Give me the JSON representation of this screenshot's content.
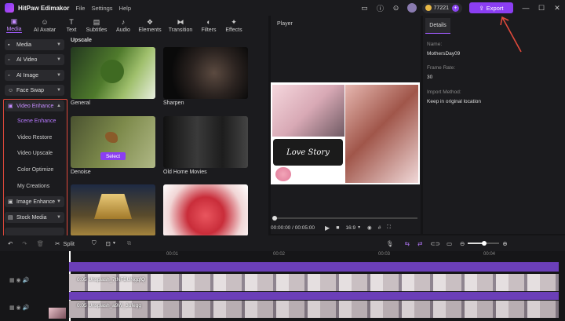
{
  "app": {
    "name": "HitPaw Edimakor",
    "menus": [
      "File",
      "Settings",
      "Help"
    ],
    "coins": "77221",
    "export_label": "Export"
  },
  "tabs": [
    {
      "label": "Media",
      "icon": "media-icon"
    },
    {
      "label": "AI Avatar",
      "icon": "avatar-icon"
    },
    {
      "label": "Text",
      "icon": "text-icon"
    },
    {
      "label": "Subtitles",
      "icon": "subtitles-icon"
    },
    {
      "label": "Audio",
      "icon": "audio-icon"
    },
    {
      "label": "Elements",
      "icon": "elements-icon"
    },
    {
      "label": "Transition",
      "icon": "transition-icon"
    },
    {
      "label": "Filters",
      "icon": "filters-icon"
    },
    {
      "label": "Effects",
      "icon": "effects-icon"
    }
  ],
  "sidebar": {
    "media": "Media",
    "ai_video": "AI Video",
    "ai_image": "AI Image",
    "face_swap": "Face Swap",
    "video_enhance": "Video Enhance",
    "subitems": [
      "Scene Enhance",
      "Video Restore",
      "Video Upscale",
      "Color Optimize",
      "My Creations"
    ],
    "image_enhance": "Image Enhance",
    "stock_media": "Stock Media"
  },
  "content": {
    "category": "Upscale",
    "items": [
      {
        "label": "General"
      },
      {
        "label": "Sharpen"
      },
      {
        "label": "Denoise"
      },
      {
        "label": "Old Home Movies"
      }
    ],
    "select_label": "Select"
  },
  "player": {
    "title": "Player",
    "time": "00:00:00 / 00:05:00",
    "ratio": "16:9",
    "love_story": "Love Story"
  },
  "details": {
    "tab": "Details",
    "name_label": "Name:",
    "name_value": "MothersDay09",
    "fps_label": "Frame Rate:",
    "fps_value": "30",
    "import_label": "Import Method:",
    "import_value": "Keep in original location"
  },
  "timeline": {
    "split_label": "Split",
    "ticks": [
      "00:01",
      "00:02",
      "00:03",
      "00:04"
    ],
    "clip1": "0:05 Unsplash_7tNFBUNgqfQ",
    "clip2": "0:05 Unsplash_a9W_3ufegg",
    "progress": 0.5
  }
}
